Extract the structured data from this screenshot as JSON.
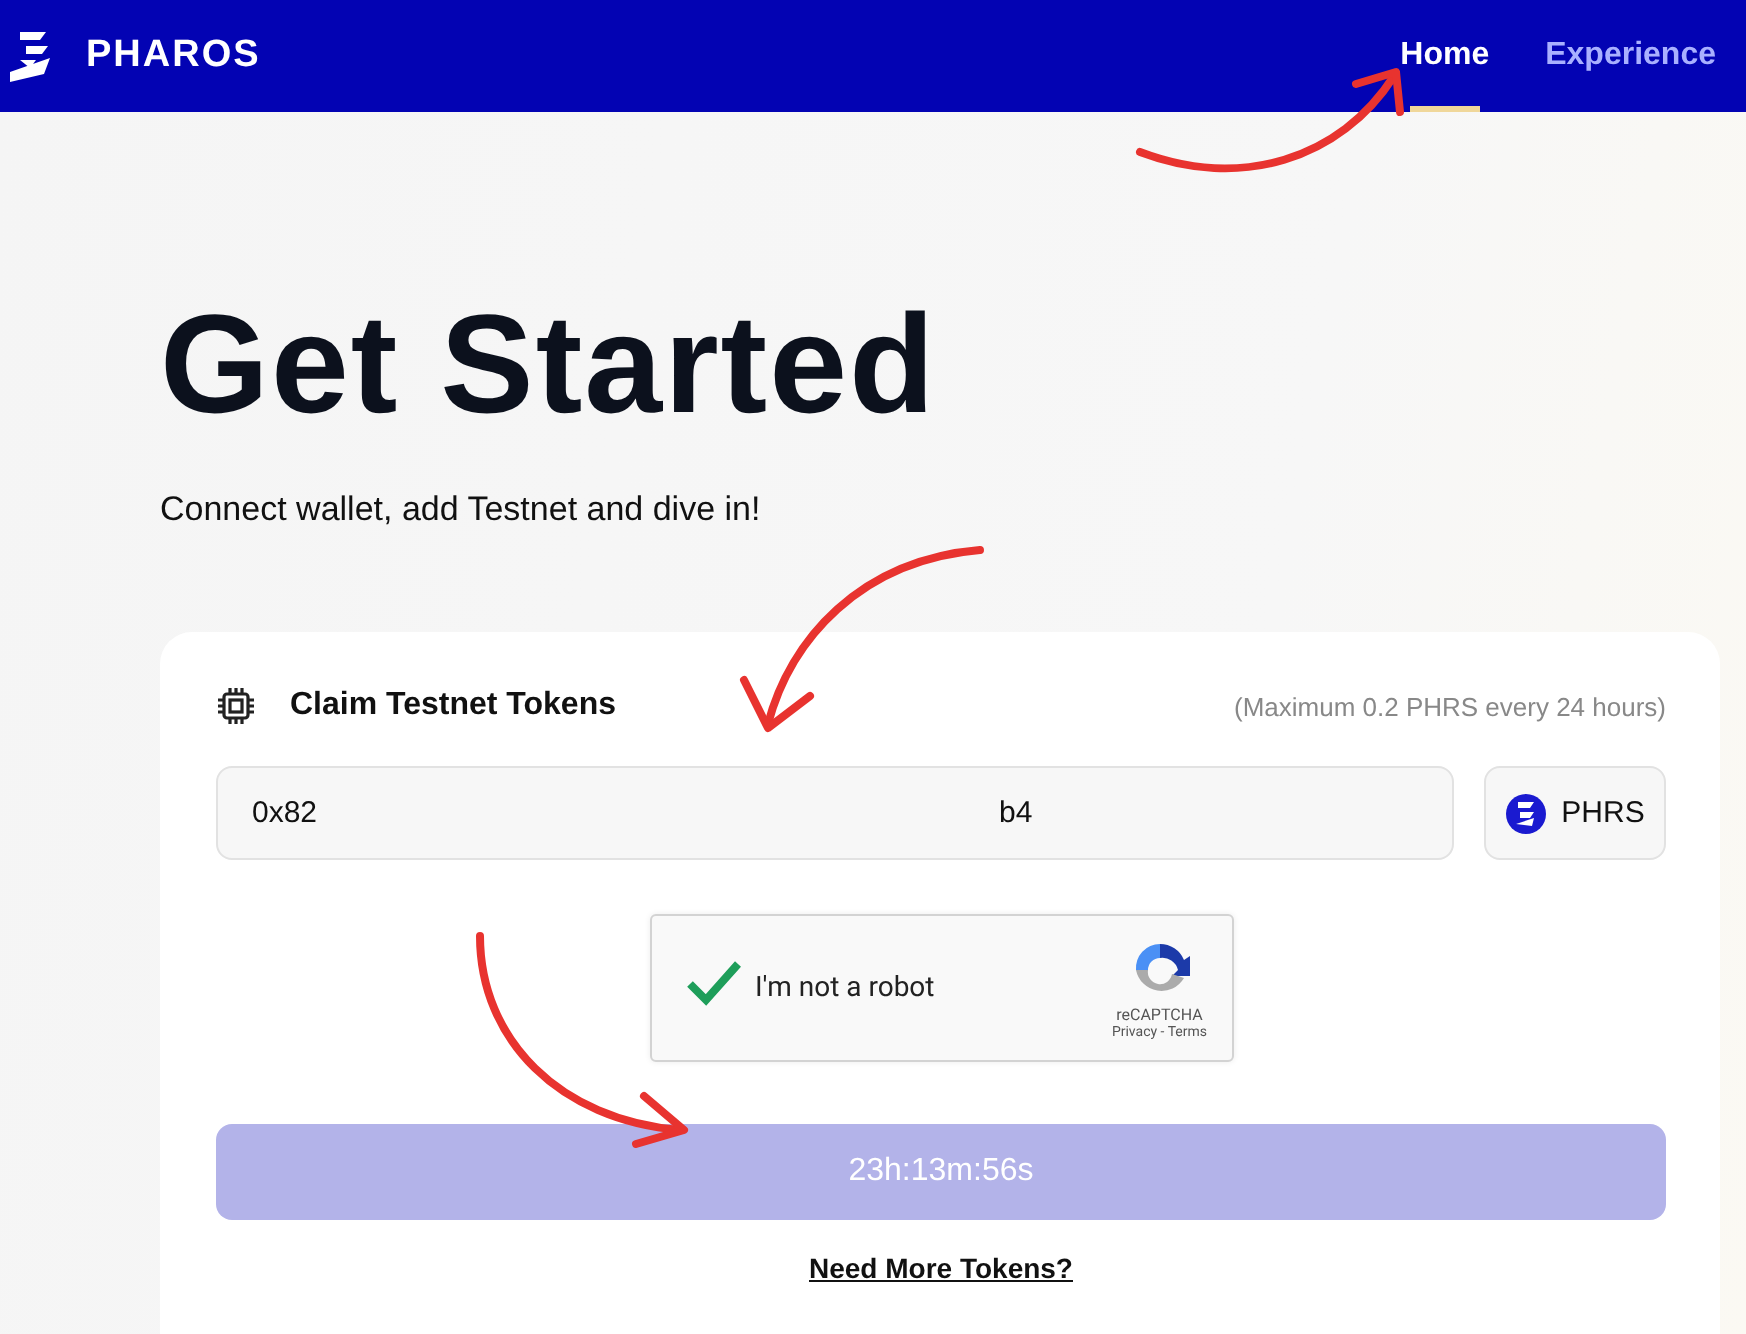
{
  "header": {
    "brand": "PHAROS",
    "nav": [
      {
        "label": "Home",
        "selected": true
      },
      {
        "label": "Experience",
        "selected": false
      }
    ]
  },
  "hero": {
    "title": "Get Started",
    "subtitle": "Connect wallet, add Testnet and dive in!"
  },
  "card": {
    "title": "Claim Testnet Tokens",
    "note": "(Maximum 0.2 PHRS every 24 hours)",
    "address": {
      "start": "0x82",
      "end": "b4"
    },
    "token": "PHRS",
    "captcha": {
      "label": "I'm not a robot",
      "checked": true,
      "brand": "reCAPTCHA",
      "links": "Privacy - Terms"
    },
    "claim_button": {
      "label": "23h:13m:56s",
      "disabled": true
    },
    "link": "Need More Tokens?"
  },
  "annotations": [
    {
      "kind": "arrow"
    },
    {
      "kind": "arrow"
    },
    {
      "kind": "arrow"
    }
  ]
}
